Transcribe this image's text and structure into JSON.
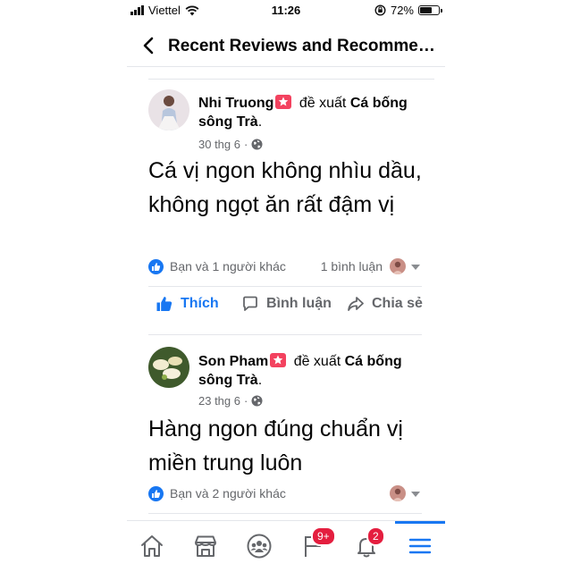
{
  "status": {
    "carrier": "Viettel",
    "time": "11:26",
    "battery": "72%",
    "battery_level": 0.72
  },
  "header": {
    "title": "Recent Reviews and Recommen..."
  },
  "posts": [
    {
      "name": "Nhi Truong",
      "verb": "đề xuất",
      "target": "Cá bống sông Trà",
      "date": "30 thg 6",
      "body": "Cá vị ngon không nhìu dầu, không ngọt ăn rất đậm vị",
      "reactions": "Bạn và 1 người khác",
      "comments": "1 bình luận"
    },
    {
      "name": "Son Pham",
      "verb": "đề xuất",
      "target": "Cá bống sông Trà",
      "date": "23 thg 6",
      "body": "Hàng ngon đúng chuẩn vị miền trung luôn",
      "reactions": "Bạn và 2 người khác",
      "comments": ""
    }
  ],
  "actions": {
    "like": "Thích",
    "comment": "Bình luận",
    "share": "Chia sẻ"
  },
  "tabbar": {
    "tabs": [
      "home-icon",
      "marketplace-icon",
      "groups-icon",
      "pages-icon",
      "notifications-icon",
      "menu-icon"
    ],
    "pages_badge": "9+",
    "notifications_badge": "2",
    "active": "menu-icon"
  },
  "colors": {
    "accent": "#1877f2",
    "badge_red": "#e41e3f",
    "recommend_badge": "#f3425f",
    "muted": "#65676b"
  }
}
